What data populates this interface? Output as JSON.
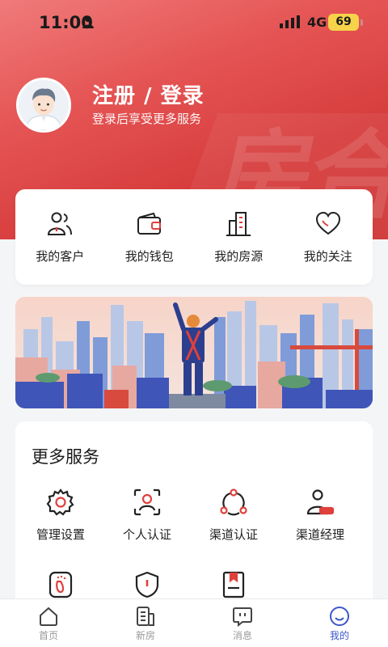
{
  "status_bar": {
    "time": "11:00",
    "network": "4G",
    "battery": "69"
  },
  "profile": {
    "title": "注册 / 登录",
    "subtitle": "登录后享受更多服务",
    "watermark": "房合"
  },
  "quick_actions": [
    {
      "label": "我的客户",
      "icon": "customers-icon"
    },
    {
      "label": "我的钱包",
      "icon": "wallet-icon"
    },
    {
      "label": "我的房源",
      "icon": "building-icon"
    },
    {
      "label": "我的关注",
      "icon": "heart-icon"
    }
  ],
  "services": {
    "title": "更多服务",
    "items": [
      {
        "label": "管理设置",
        "icon": "gear-icon"
      },
      {
        "label": "个人认证",
        "icon": "face-scan-icon"
      },
      {
        "label": "渠道认证",
        "icon": "network-icon"
      },
      {
        "label": "渠道经理",
        "icon": "manager-icon"
      },
      {
        "label": "",
        "icon": "footprint-icon"
      },
      {
        "label": "",
        "icon": "shield-icon"
      },
      {
        "label": "",
        "icon": "bookmark-book-icon"
      }
    ]
  },
  "tabbar": [
    {
      "label": "首页",
      "icon": "home-icon",
      "active": false
    },
    {
      "label": "新房",
      "icon": "building-doc-icon",
      "active": false
    },
    {
      "label": "消息",
      "icon": "message-icon",
      "active": false
    },
    {
      "label": "我的",
      "icon": "smile-icon",
      "active": true
    }
  ],
  "colors": {
    "brand_red": "#d63b3b",
    "accent_blue": "#3b57c8",
    "icon_red": "#e0403c"
  }
}
